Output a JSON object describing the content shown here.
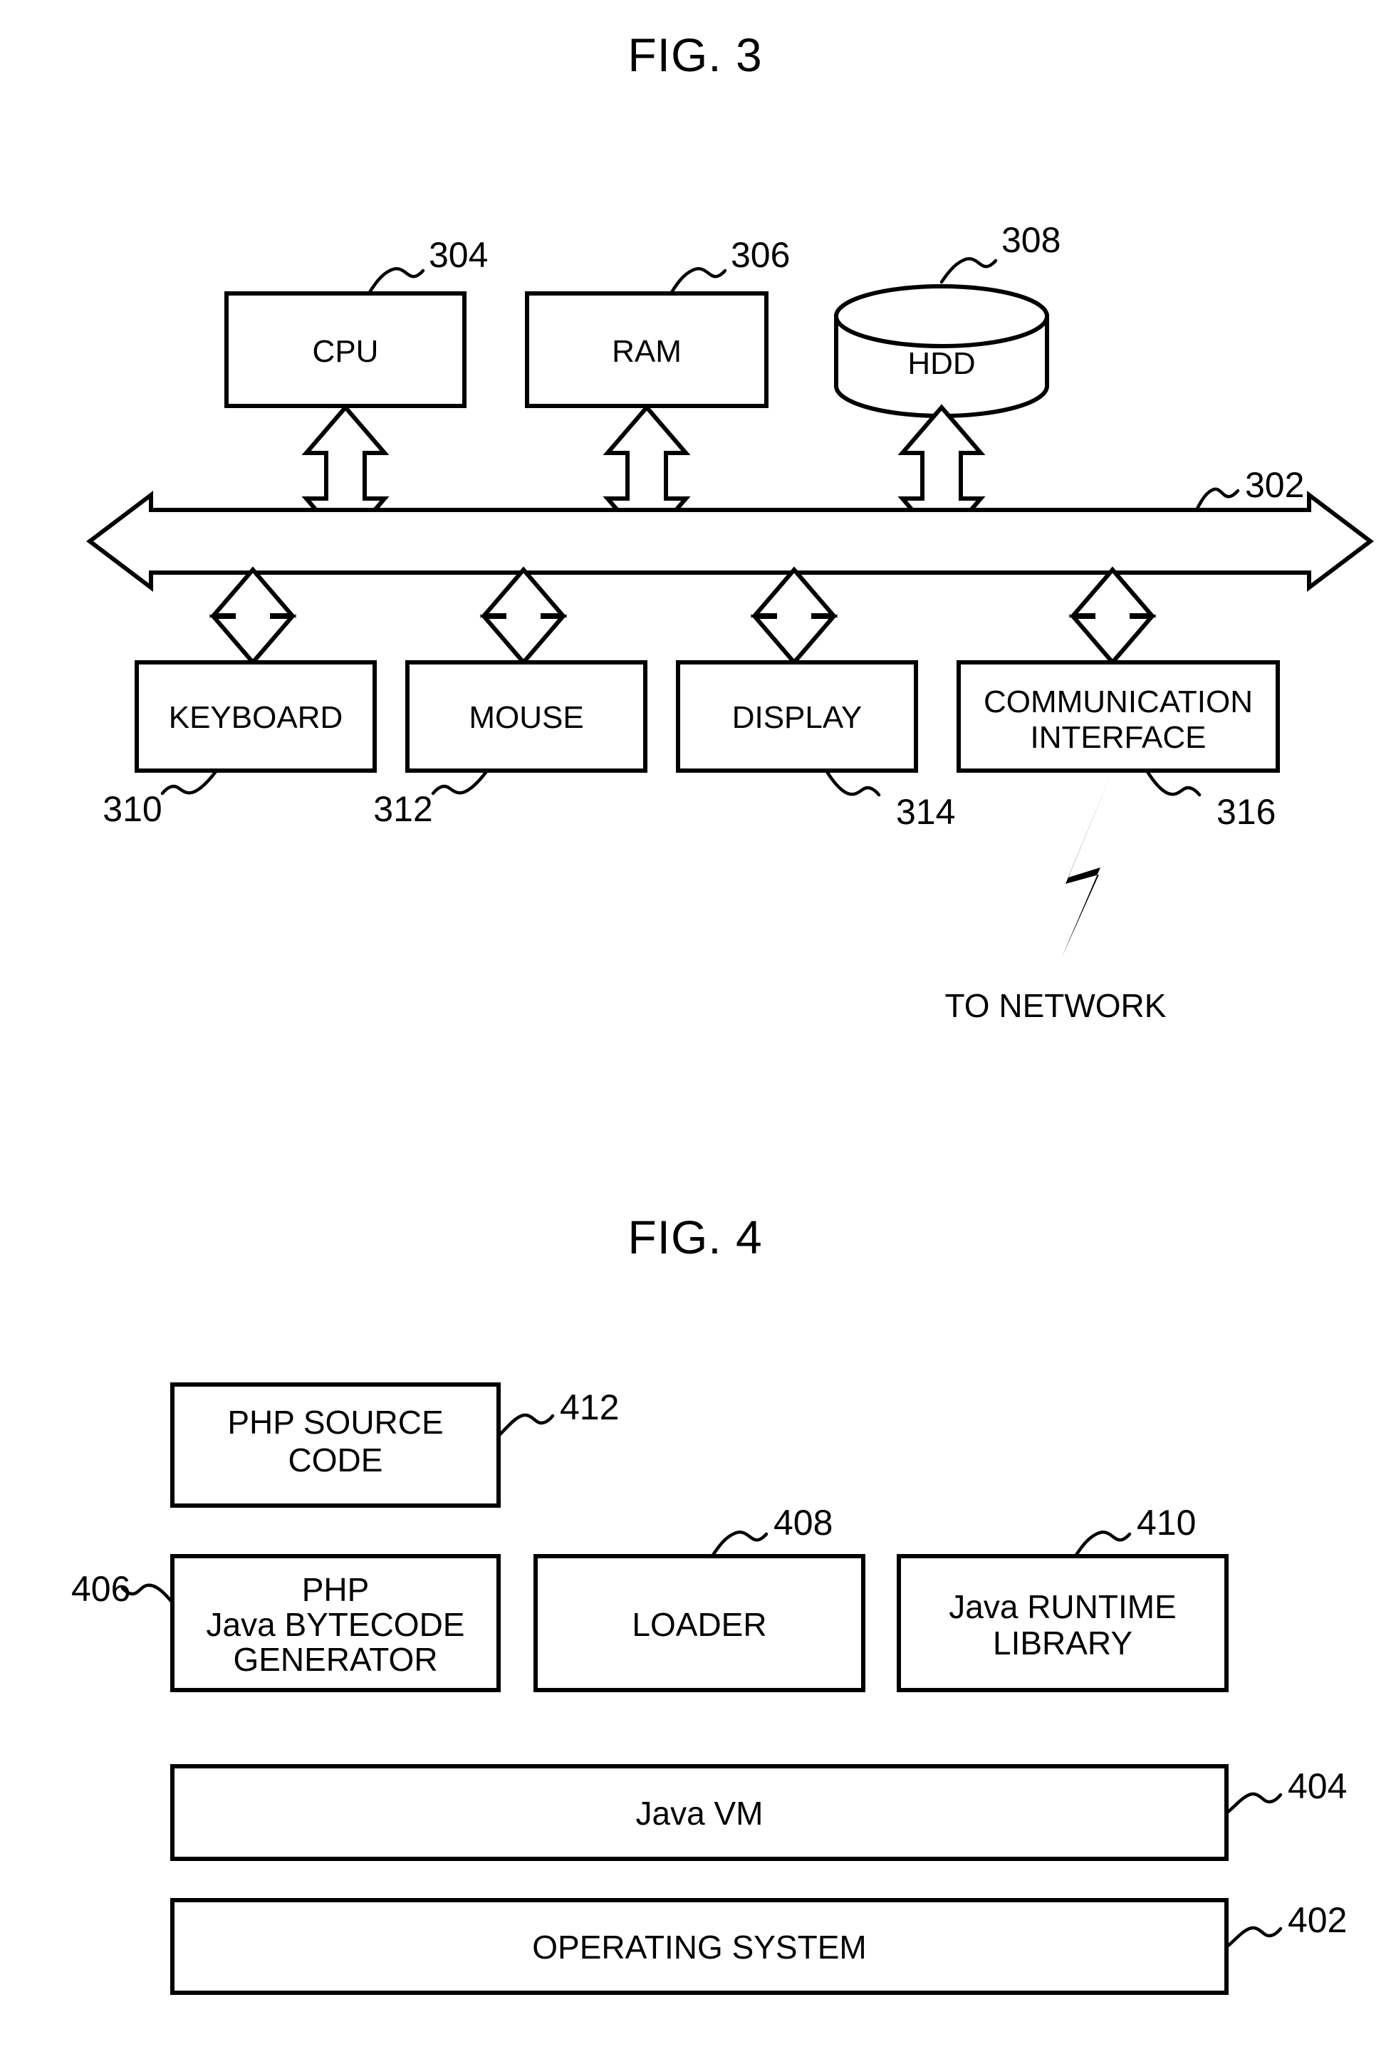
{
  "figures": [
    {
      "id": "fig3",
      "title": "FIG. 3",
      "bus": {
        "ref": "302",
        "name": "bus"
      },
      "top_components": [
        {
          "label": "CPU",
          "ref": "304",
          "shape": "rect"
        },
        {
          "label": "RAM",
          "ref": "306",
          "shape": "rect"
        },
        {
          "label": "HDD",
          "ref": "308",
          "shape": "cylinder"
        }
      ],
      "bottom_components": [
        {
          "label": "KEYBOARD",
          "ref": "310",
          "shape": "rect"
        },
        {
          "label": "MOUSE",
          "ref": "312",
          "shape": "rect"
        },
        {
          "label": "DISPLAY",
          "ref": "314",
          "shape": "rect"
        },
        {
          "label_line1": "COMMUNICATION",
          "label_line2": "INTERFACE",
          "ref": "316",
          "shape": "rect"
        }
      ],
      "network_label": "TO NETWORK"
    },
    {
      "id": "fig4",
      "title": "FIG. 4",
      "layers": [
        {
          "label_line1": "PHP SOURCE",
          "label_line2": "CODE",
          "ref": "412"
        },
        {
          "label_line1": "PHP",
          "label_line2": "Java BYTECODE",
          "label_line3": "GENERATOR",
          "ref": "406"
        },
        {
          "label": "LOADER",
          "ref": "408"
        },
        {
          "label_line1": "Java RUNTIME",
          "label_line2": "LIBRARY",
          "ref": "410"
        },
        {
          "label": "Java VM",
          "ref": "404"
        },
        {
          "label": "OPERATING SYSTEM",
          "ref": "402"
        }
      ]
    }
  ],
  "colors": {
    "ink": "#000000",
    "paper": "#ffffff"
  }
}
